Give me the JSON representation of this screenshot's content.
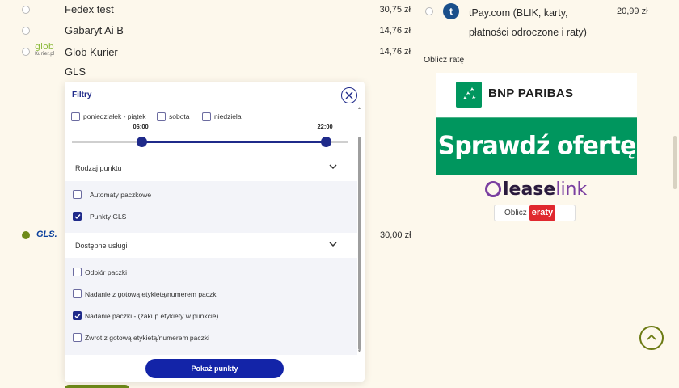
{
  "carriers": [
    {
      "name": "Fedex test",
      "price": "30,75 zł"
    },
    {
      "name": "Gabaryt Ai B",
      "price": "14,76 zł"
    },
    {
      "name": "Glob Kurier",
      "price": "14,76 zł",
      "logo_main": "glob",
      "logo_sub": "Kurier.pl"
    },
    {
      "name": "GLS",
      "price": ""
    }
  ],
  "gls_row": {
    "logo": "GLS.",
    "price": "30,00 zł"
  },
  "payment": {
    "tpay_logo": "t",
    "tpay_label": "tPay.com (BLIK, karty, płatności odroczone i raty)",
    "tpay_price": "20,99 zł",
    "oblicz_rate": "Oblicz ratę"
  },
  "ads": {
    "bnp_text": "BNP PARIBAS",
    "bnp_banner": "Sprawdź ofertę",
    "leaselink_a": "lease",
    "leaselink_b": "link",
    "eraty_prefix": "Oblicz",
    "eraty_brand": "eraty"
  },
  "filters": {
    "title": "Filtry",
    "days": [
      {
        "label": "poniedziałek - piątek",
        "checked": false
      },
      {
        "label": "sobota",
        "checked": false
      },
      {
        "label": "niedziela",
        "checked": false
      }
    ],
    "time_from": "06:00",
    "time_to": "22:00",
    "time_from_value": 0.25,
    "time_to_value": 0.9167,
    "point_type": {
      "title": "Rodzaj punktu",
      "options": [
        {
          "label": "Automaty paczkowe",
          "checked": false
        },
        {
          "label": "Punkty GLS",
          "checked": true
        }
      ]
    },
    "services": {
      "title": "Dostępne usługi",
      "options": [
        {
          "label": "Odbiór paczki",
          "checked": false
        },
        {
          "label": "Nadanie z gotową etykietą/numerem paczki",
          "checked": false
        },
        {
          "label": "Nadanie paczki - (zakup etykiety w punkcie)",
          "checked": true
        },
        {
          "label": "Zwrot z gotową etykietą/numerem paczki",
          "checked": false
        }
      ]
    },
    "show_button": "Pokaż punkty"
  },
  "colors": {
    "accent": "#1f2a8a",
    "button": "#1324a8",
    "bnp_green": "#00965e",
    "brand_olive": "#6e8a18"
  }
}
